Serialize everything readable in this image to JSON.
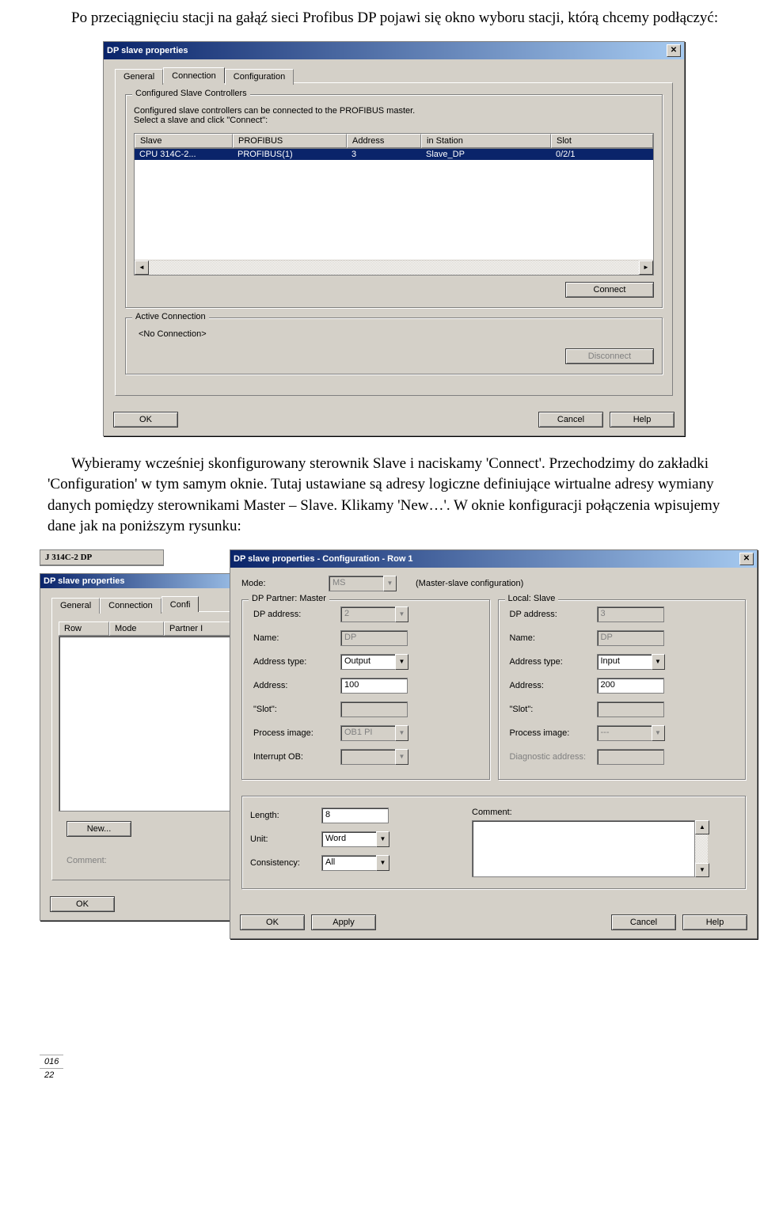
{
  "page_text": {
    "para1": "Po przeciągnięciu stacji na gałąź sieci Profibus DP pojawi się okno wyboru stacji, którą chcemy podłączyć:",
    "para2": "Wybieramy wcześniej skonfigurowany sterownik Slave i naciskamy 'Connect'. Przechodzimy do zakładki 'Configuration' w tym samym oknie. Tutaj ustawiane są adresy logiczne definiujące wirtualne adresy wymiany danych pomiędzy sterownikami Master – Slave. Klikamy 'New…'. W oknie konfiguracji połączenia wpisujemy dane jak na poniższym rysunku:"
  },
  "dialog1": {
    "title": "DP slave properties",
    "tabs": {
      "general": "General",
      "connection": "Connection",
      "configuration": "Configuration"
    },
    "group_top": {
      "legend": "Configured Slave Controllers",
      "hint1": "Configured slave controllers can be connected to the PROFIBUS master.",
      "hint2": "Select a slave and click \"Connect\":"
    },
    "list": {
      "headers": {
        "slave": "Slave",
        "profibus": "PROFIBUS",
        "address": "Address",
        "in_station": "in Station",
        "slot": "Slot"
      },
      "row": {
        "slave": "CPU 314C-2...",
        "profibus": "PROFIBUS(1)",
        "address": "3",
        "in_station": "Slave_DP",
        "slot": "0/2/1"
      }
    },
    "connect": "Connect",
    "group_active": {
      "legend": "Active Connection",
      "text": "<No Connection>",
      "disconnect": "Disconnect"
    },
    "buttons": {
      "ok": "OK",
      "cancel": "Cancel",
      "help": "Help"
    }
  },
  "narrow_top": {
    "header": "J 314C-2 DP"
  },
  "dialog_back": {
    "title": "DP slave properties",
    "tabs": {
      "general": "General",
      "connection": "Connection",
      "configuration": "Confi"
    },
    "headers": {
      "row": "Row",
      "mode": "Mode",
      "partner": "Partner I"
    },
    "new": "New...",
    "comment_label": "Comment:",
    "ok": "OK"
  },
  "dialog2": {
    "title": "DP slave properties - Configuration - Row 1",
    "mode": {
      "label": "Mode:",
      "value": "MS",
      "hint": "(Master-slave configuration)"
    },
    "partner_group": "DP Partner: Master",
    "local_group": "Local: Slave",
    "labels": {
      "dp_address": "DP address:",
      "name": "Name:",
      "addr_type": "Address type:",
      "address": "Address:",
      "slot": "\"Slot\":",
      "proc_img": "Process image:",
      "int_ob": "Interrupt OB:",
      "diag_addr": "Diagnostic address:",
      "length": "Length:",
      "unit": "Unit:",
      "consistency": "Consistency:",
      "comment": "Comment:"
    },
    "partner": {
      "dp_address": "2",
      "name": "DP",
      "addr_type": "Output",
      "address": "100",
      "slot": "",
      "proc_img": "OB1 PI",
      "int_ob": ""
    },
    "local": {
      "dp_address": "3",
      "name": "DP",
      "addr_type": "Input",
      "address": "200",
      "slot": "",
      "proc_img": "---",
      "diag_addr": ""
    },
    "bottom": {
      "length": "8",
      "unit": "Word",
      "consistency": "All"
    },
    "buttons": {
      "ok": "OK",
      "apply": "Apply",
      "cancel": "Cancel",
      "help": "Help"
    }
  },
  "bottom_fragment": {
    "r1": "016",
    "r2": "22"
  }
}
